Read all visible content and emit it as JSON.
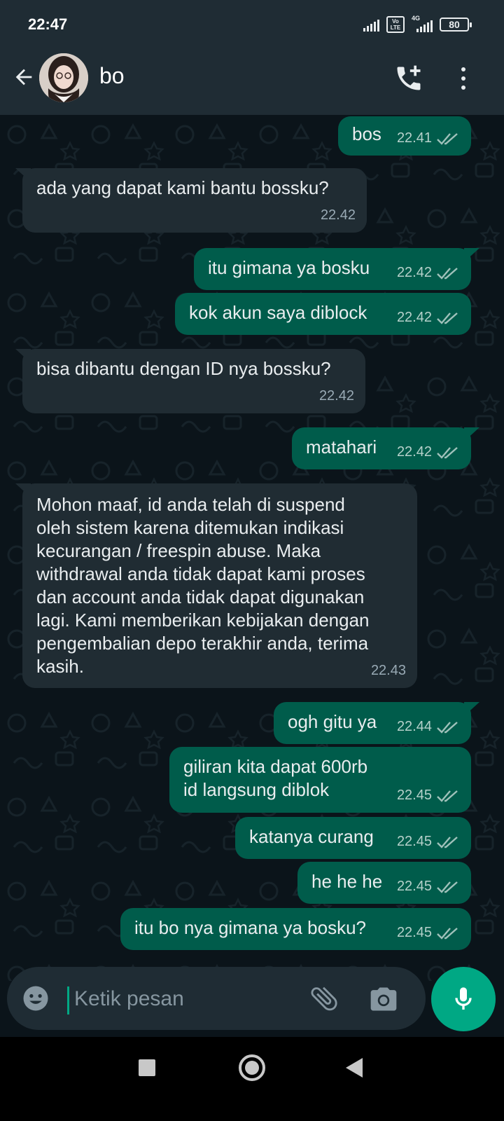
{
  "status_bar": {
    "time": "22:47",
    "volte": "Vo LTE",
    "network": "4G",
    "battery": "80",
    "icons": [
      "signal-icon",
      "volte-icon",
      "4g-signal-icon",
      "battery-icon"
    ]
  },
  "header": {
    "contact_name": "bo",
    "icons": [
      "back-arrow-icon",
      "avatar-photo",
      "add-call-icon",
      "more-vert-icon"
    ]
  },
  "messages": [
    {
      "dir": "out",
      "text": "bos",
      "time": "22.41",
      "status": "read"
    },
    {
      "dir": "in",
      "text": "ada yang dapat kami bantu bossku?",
      "time": "22.42"
    },
    {
      "dir": "out",
      "text": "itu gimana ya bosku",
      "time": "22.42",
      "status": "read"
    },
    {
      "dir": "out",
      "text": "kok akun saya diblock",
      "time": "22.42",
      "status": "read"
    },
    {
      "dir": "in",
      "text": "bisa dibantu dengan ID nya bossku?",
      "time": "22.42"
    },
    {
      "dir": "out",
      "text": "matahari",
      "time": "22.42",
      "status": "read"
    },
    {
      "dir": "in",
      "text": "Mohon maaf, id anda telah di suspend\noleh sistem karena ditemukan indikasi\nkecurangan / freespin abuse. Maka\nwithdrawal anda tidak dapat kami proses\ndan account anda tidak dapat digunakan\nlagi. Kami memberikan kebijakan dengan\npengembalian depo terakhir anda, terima\nkasih.",
      "time": "22.43"
    },
    {
      "dir": "out",
      "text": "ogh gitu ya",
      "time": "22.44",
      "status": "read"
    },
    {
      "dir": "out",
      "text": "giliran kita dapat 600rb\nid langsung diblok",
      "time": "22.45",
      "status": "read"
    },
    {
      "dir": "out",
      "text": "katanya curang",
      "time": "22.45",
      "status": "read"
    },
    {
      "dir": "out",
      "text": "he he he",
      "time": "22.45",
      "status": "read"
    },
    {
      "dir": "out",
      "text": "itu bo nya gimana ya bosku?",
      "time": "22.45",
      "status": "read"
    }
  ],
  "composer": {
    "placeholder": "Ketik pesan",
    "value": "",
    "icons": [
      "emoji-icon",
      "attach-icon",
      "camera-icon",
      "mic-icon"
    ]
  },
  "nav_bar": {
    "icons": [
      "recents-icon",
      "home-icon",
      "back-icon"
    ]
  },
  "colors": {
    "background": "#0b141a",
    "header": "#1f2c34",
    "incoming_bubble": "#202c33",
    "outgoing_bubble": "#005c4b",
    "accent": "#00a884",
    "read_ticks": "#9fc1ba"
  }
}
